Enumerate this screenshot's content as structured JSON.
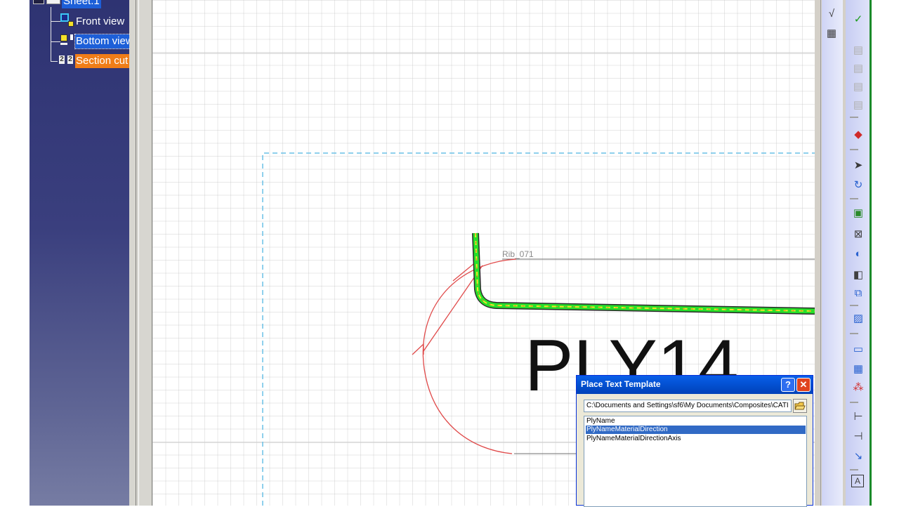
{
  "tree": {
    "sheet_label": "Sheet.1",
    "views": [
      {
        "label": "Front view",
        "state": "normal"
      },
      {
        "label": "Bottom view",
        "state": "selected"
      },
      {
        "label": "Section cut",
        "state": "highlighted"
      }
    ]
  },
  "drawing": {
    "rib_label": "Rib_071",
    "ply_text": "PLY14"
  },
  "toolbar": {
    "icons": [
      "dimension-icon",
      "curve-icon",
      "grid-icon",
      "disabled-icon-1",
      "disabled-icon-2",
      "disabled-icon-3",
      "disabled-icon-4",
      "3d-view-icon",
      "select-pointer-icon",
      "rotate-icon",
      "view-align-icon",
      "view-props-icon",
      "paint-icon",
      "position-icon",
      "frame-icon",
      "image-icon",
      "frame-rect-icon",
      "color-icon",
      "nodes-icon",
      "dimension-h-icon",
      "dimension-v-icon",
      "line-icon",
      "text-icon"
    ]
  },
  "dialog": {
    "title": "Place Text Template",
    "help_symbol": "?",
    "close_symbol": "✕",
    "path_value": "C:\\Documents and Settings\\sf6\\My Documents\\Composites\\CATI",
    "templates": [
      {
        "label": "PlyName",
        "selected": false
      },
      {
        "label": "PlyNameMaterialDirection",
        "selected": true
      },
      {
        "label": "PlyNameMaterialDirectionAxis",
        "selected": false
      }
    ]
  },
  "colors": {
    "tree_background": "#2e3372",
    "selected_node": "#1d5fd8",
    "highlighted_node": "#f07d18",
    "dialog_title": "#0453d6",
    "list_selection": "#316ac5",
    "arc": "#e04a4a",
    "frame_dash": "#6ac0e6"
  }
}
